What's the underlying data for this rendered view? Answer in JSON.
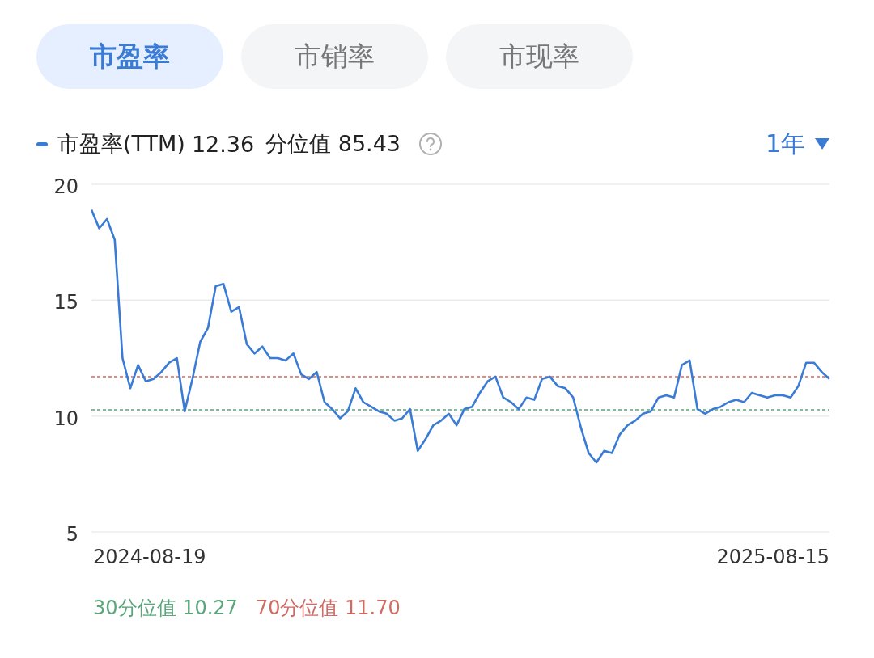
{
  "tabs": [
    {
      "label": "市盈率",
      "selected": true
    },
    {
      "label": "市销率",
      "selected": false
    },
    {
      "label": "市现率",
      "selected": false
    }
  ],
  "legend": {
    "value": "12.36",
    "percentile": "分位值 85.43"
  },
  "period": {
    "label": "1年"
  },
  "chart_data": {
    "type": "line",
    "ylim": [
      5,
      20
    ],
    "yticks": [
      5,
      10,
      15,
      20
    ],
    "series": [
      {
        "name": "市盈率(TTM)",
        "color": "#3a7bd5",
        "values": [
          18.9,
          18.1,
          18.5,
          17.6,
          12.5,
          11.2,
          12.2,
          11.5,
          11.6,
          11.9,
          12.3,
          12.5,
          10.2,
          11.6,
          13.2,
          13.8,
          15.6,
          15.7,
          14.5,
          14.7,
          13.1,
          12.7,
          13.0,
          12.5,
          12.5,
          12.4,
          12.7,
          11.8,
          11.6,
          11.9,
          10.6,
          10.3,
          9.9,
          10.2,
          11.2,
          10.6,
          10.4,
          10.2,
          10.1,
          9.8,
          9.9,
          10.3,
          8.5,
          9.0,
          9.6,
          9.8,
          10.1,
          9.6,
          10.3,
          10.4,
          11.0,
          11.5,
          11.7,
          10.8,
          10.6,
          10.3,
          10.8,
          10.7,
          11.6,
          11.7,
          11.3,
          11.2,
          10.8,
          9.5,
          8.4,
          8.0,
          8.5,
          8.4,
          9.2,
          9.6,
          9.8,
          10.1,
          10.2,
          10.8,
          10.9,
          10.8,
          12.2,
          12.4,
          10.3,
          10.1,
          10.3,
          10.4,
          10.6,
          10.7,
          10.6,
          11.0,
          10.9,
          10.8,
          10.9,
          10.9,
          10.8,
          11.3,
          12.3,
          12.3,
          11.9,
          11.6
        ],
        "line_style": "solid"
      },
      {
        "name": "30分位值 10.27",
        "color": "#5aa57a",
        "line_style": "dashed",
        "values": [
          10.27,
          10.27,
          10.27,
          10.27,
          10.27,
          10.27,
          10.27,
          10.27,
          10.27,
          10.27,
          10.27,
          10.27,
          10.27,
          10.27,
          10.27,
          10.27,
          10.27,
          10.27,
          10.27,
          10.27,
          10.27,
          10.27,
          10.27,
          10.27,
          10.27,
          10.27,
          10.27,
          10.27,
          10.27,
          10.27,
          10.27,
          10.27,
          10.27,
          10.27,
          10.27,
          10.27,
          10.27,
          10.27,
          10.27,
          10.27,
          10.27,
          10.27,
          10.27,
          10.27,
          10.27,
          10.27,
          10.27,
          10.27,
          10.27,
          10.27,
          10.27,
          10.27,
          10.27,
          10.27,
          10.27,
          10.27,
          10.27,
          10.27,
          10.27,
          10.27,
          10.27,
          10.27,
          10.27,
          10.27,
          10.27,
          10.27,
          10.27,
          10.27,
          10.27,
          10.27,
          10.27,
          10.27,
          10.27,
          10.27,
          10.27,
          10.27,
          10.27,
          10.27,
          10.27,
          10.27,
          10.27,
          10.27,
          10.27,
          10.27,
          10.27,
          10.27,
          10.27,
          10.27,
          10.27,
          10.27,
          10.27,
          10.27,
          10.27,
          10.27,
          10.27,
          10.27
        ]
      },
      {
        "name": "70分位值 11.70",
        "color": "#d06a62",
        "line_style": "dashed",
        "values": [
          11.7,
          11.7,
          11.7,
          11.7,
          11.7,
          11.7,
          11.7,
          11.7,
          11.7,
          11.7,
          11.7,
          11.7,
          11.7,
          11.7,
          11.7,
          11.7,
          11.7,
          11.7,
          11.7,
          11.7,
          11.7,
          11.7,
          11.7,
          11.7,
          11.7,
          11.7,
          11.7,
          11.7,
          11.7,
          11.7,
          11.7,
          11.7,
          11.7,
          11.7,
          11.7,
          11.7,
          11.7,
          11.7,
          11.7,
          11.7,
          11.7,
          11.7,
          11.7,
          11.7,
          11.7,
          11.7,
          11.7,
          11.7,
          11.7,
          11.7,
          11.7,
          11.7,
          11.7,
          11.7,
          11.7,
          11.7,
          11.7,
          11.7,
          11.7,
          11.7,
          11.7,
          11.7,
          11.7,
          11.7,
          11.7,
          11.7,
          11.7,
          11.7,
          11.7,
          11.7,
          11.7,
          11.7,
          11.7,
          11.7,
          11.7,
          11.7,
          11.7,
          11.7,
          11.7,
          11.7,
          11.7,
          11.7,
          11.7,
          11.7,
          11.7,
          11.7,
          11.7,
          11.7,
          11.7,
          11.7,
          11.7,
          11.7,
          11.7,
          11.7,
          11.7,
          11.7
        ]
      }
    ]
  },
  "x_axis_labels": [
    "2024-08-19",
    "2025-08-15"
  ]
}
